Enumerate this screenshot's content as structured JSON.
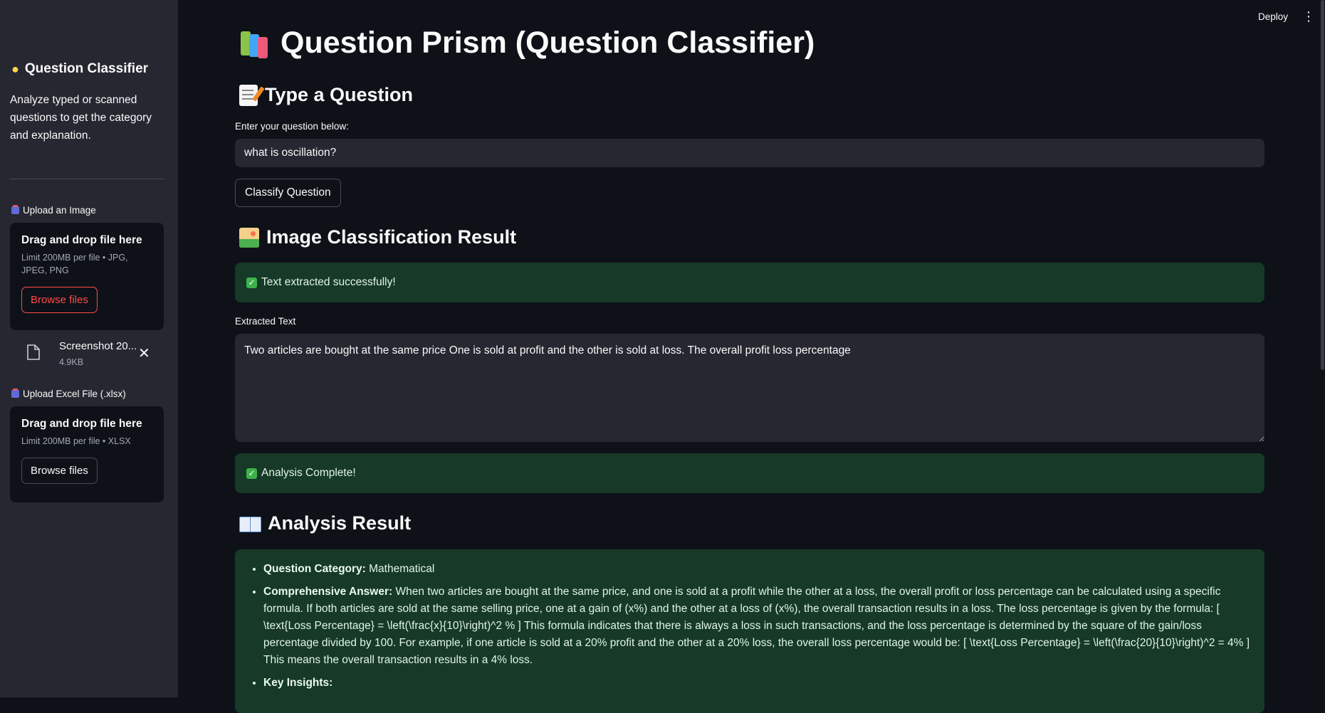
{
  "sidebar": {
    "title_icon": "lightbulb-icon",
    "title": "Question Classifier",
    "description": "Analyze typed or scanned questions to get the category and explanation.",
    "image_upload": {
      "label": "Upload an Image",
      "drop_title": "Drag and drop file here",
      "limit": "Limit 200MB per file • JPG, JPEG, PNG",
      "browse_label": "Browse files",
      "file": {
        "name": "Screenshot 20...",
        "size": "4.9KB"
      }
    },
    "excel_upload": {
      "label": "Upload Excel File (.xlsx)",
      "drop_title": "Drag and drop file here",
      "limit": "Limit 200MB per file • XLSX",
      "browse_label": "Browse files"
    }
  },
  "header": {
    "deploy_label": "Deploy",
    "menu_glyph": "⋮"
  },
  "main": {
    "title": "Question Prism (Question Classifier)",
    "type_section": {
      "heading": "Type a Question",
      "input_label": "Enter your question below:",
      "input_value": "what is oscillation?",
      "button_label": "Classify Question"
    },
    "image_section": {
      "heading": "Image Classification Result",
      "success_message": "Text extracted successfully!",
      "extracted_label": "Extracted Text",
      "extracted_text": "Two articles are bought at the same price One is sold at profit and the other is sold at loss. The overall profit loss percentage",
      "analysis_message": "Analysis Complete!"
    },
    "analysis_section": {
      "heading": "Analysis Result",
      "category_label": "Question Category:",
      "category_value": "Mathematical",
      "answer_label": "Comprehensive Answer:",
      "answer_text": "When two articles are bought at the same price, and one is sold at a profit while the other at a loss, the overall profit or loss percentage can be calculated using a specific formula. If both articles are sold at the same selling price, one at a gain of (x%) and the other at a loss of (x%), the overall transaction results in a loss. The loss percentage is given by the formula: [ \\text{Loss Percentage} = \\left(\\frac{x}{10}\\right)^2 % ] This formula indicates that there is always a loss in such transactions, and the loss percentage is determined by the square of the gain/loss percentage divided by 100. For example, if one article is sold at a 20% profit and the other at a 20% loss, the overall loss percentage would be: [ \\text{Loss Percentage} = \\left(\\frac{20}{10}\\right)^2 = 4% ] This means the overall transaction results in a 4% loss.",
      "insights_label": "Key Insights:"
    }
  },
  "colors": {
    "background": "#0e1117",
    "sidebar": "#262730",
    "success_bg": "#173928",
    "accent_red": "#ff4b4b"
  }
}
